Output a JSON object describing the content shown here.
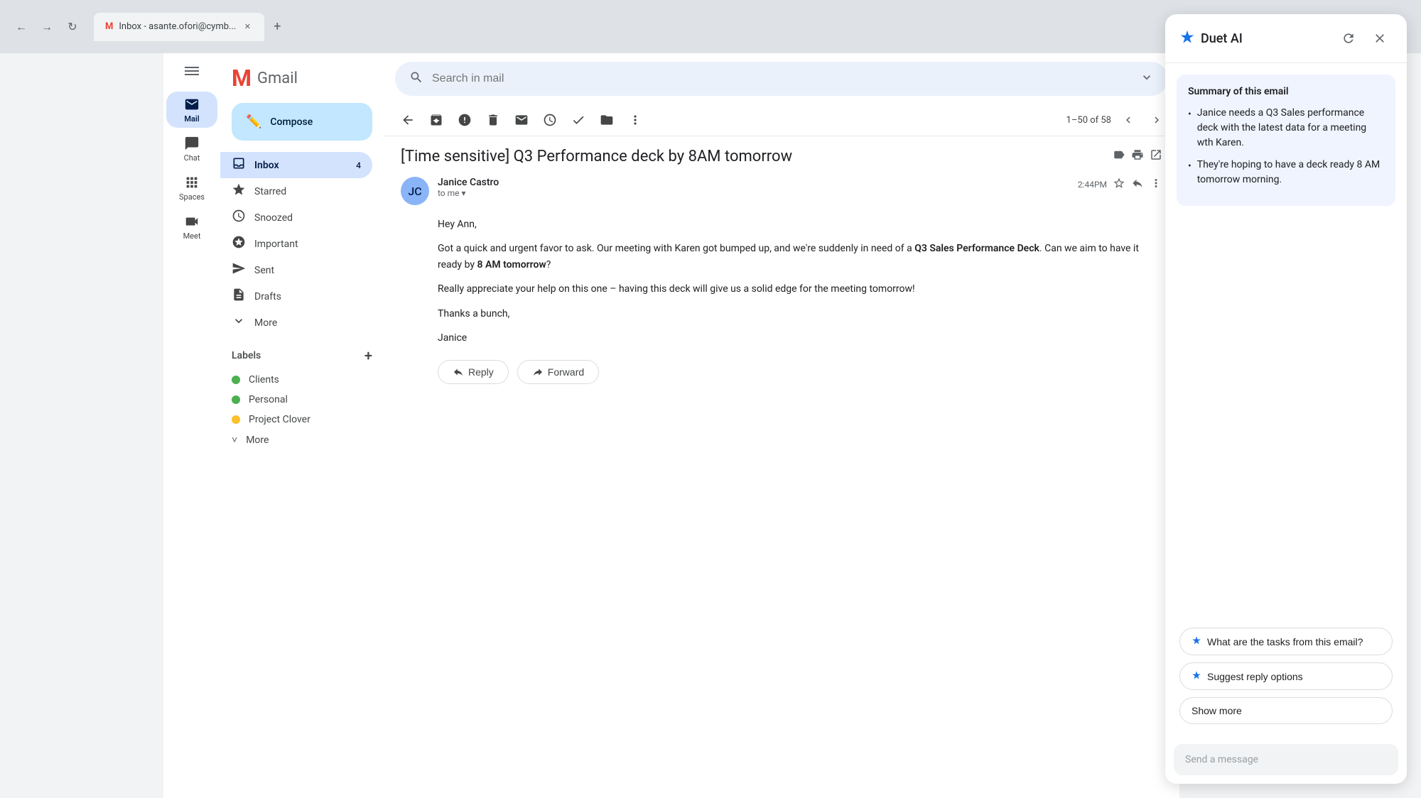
{
  "browser": {
    "tab_title": "Inbox - asante.ofori@cymb...",
    "tab_favicon": "M",
    "new_tab_label": "+",
    "nav_back": "←",
    "nav_forward": "→",
    "nav_refresh": "↻"
  },
  "gmail": {
    "logo_text": "Gmail",
    "logo_letter": "M"
  },
  "search": {
    "placeholder": "Search in mail"
  },
  "sidebar": {
    "items": [
      {
        "id": "mail",
        "label": "Mail",
        "icon": "✉",
        "active": true
      },
      {
        "id": "chat",
        "label": "Chat",
        "icon": "💬",
        "active": false
      },
      {
        "id": "spaces",
        "label": "Spaces",
        "icon": "⊞",
        "active": false
      },
      {
        "id": "meet",
        "label": "Meet",
        "icon": "📹",
        "active": false
      }
    ]
  },
  "nav": {
    "compose_label": "Compose",
    "items": [
      {
        "id": "inbox",
        "label": "Inbox",
        "icon": "📥",
        "count": "4",
        "active": true
      },
      {
        "id": "starred",
        "label": "Starred",
        "icon": "☆",
        "count": "",
        "active": false
      },
      {
        "id": "snoozed",
        "label": "Snoozed",
        "icon": "🕐",
        "count": "",
        "active": false
      },
      {
        "id": "important",
        "label": "Important",
        "icon": "▷",
        "count": "",
        "active": false
      },
      {
        "id": "sent",
        "label": "Sent",
        "icon": "➤",
        "count": "",
        "active": false
      },
      {
        "id": "drafts",
        "label": "Drafts",
        "icon": "📄",
        "count": "",
        "active": false
      },
      {
        "id": "more",
        "label": "More",
        "icon": "˅",
        "count": "",
        "active": false
      }
    ]
  },
  "labels": {
    "header": "Labels",
    "add_label": "+",
    "items": [
      {
        "id": "clients",
        "label": "Clients",
        "color": "#4caf50"
      },
      {
        "id": "personal",
        "label": "Personal",
        "color": "#4caf50"
      },
      {
        "id": "project-clover",
        "label": "Project Clover",
        "color": "#fbc02d"
      },
      {
        "id": "more-labels",
        "label": "More",
        "color": ""
      }
    ]
  },
  "toolbar": {
    "back_label": "←",
    "archive_icon": "archive",
    "spam_icon": "report",
    "delete_icon": "delete",
    "email_icon": "email",
    "snooze_icon": "alarm",
    "done_icon": "done",
    "folder_icon": "folder",
    "more_icon": "⋮",
    "pagination": "1–50 of 58"
  },
  "email": {
    "subject": "[Time sensitive] Q3 Performance deck by 8AM tomorrow",
    "sender_name": "Janice Castro",
    "sender_to": "to me",
    "time": "2:44PM",
    "avatar_initials": "JC",
    "body_greeting": "Hey Ann,",
    "body_p1": "Got a quick and urgent favor to ask. Our meeting with Karen got bumped up, and we're suddenly in need of a Q3 Sales Performance Deck. Can we aim to have it ready by 8 AM tomorrow?",
    "bold_1": "Q3 Sales Performance Deck",
    "bold_2": "8 AM tomorrow",
    "body_p2": "Really appreciate your help on this one – having this deck will give us a solid edge for the meeting tomorrow!",
    "body_closing": "Thanks a bunch,",
    "body_signature": "Janice",
    "reply_label": "Reply",
    "forward_label": "Forward"
  },
  "duet": {
    "title": "Duet AI",
    "refresh_icon": "↻",
    "close_icon": "✕",
    "summary_title": "Summary of this email",
    "bullets": [
      "Janice needs a Q3 Sales performance deck with the latest data for a meeting wth Karen.",
      "They're hoping to have a deck ready 8 AM tomorrow morning."
    ],
    "actions": [
      {
        "id": "tasks",
        "label": "What are the tasks from this email?"
      },
      {
        "id": "suggest-reply",
        "label": "Suggest reply options"
      }
    ],
    "show_more_label": "Show more",
    "message_placeholder": "Send a message"
  },
  "avatars": [
    {
      "id": "avatar1",
      "color": "#8ab4f8"
    },
    {
      "id": "avatar2",
      "color": "#e8a0bf"
    },
    {
      "id": "avatar3",
      "color": "#f6be00"
    }
  ]
}
